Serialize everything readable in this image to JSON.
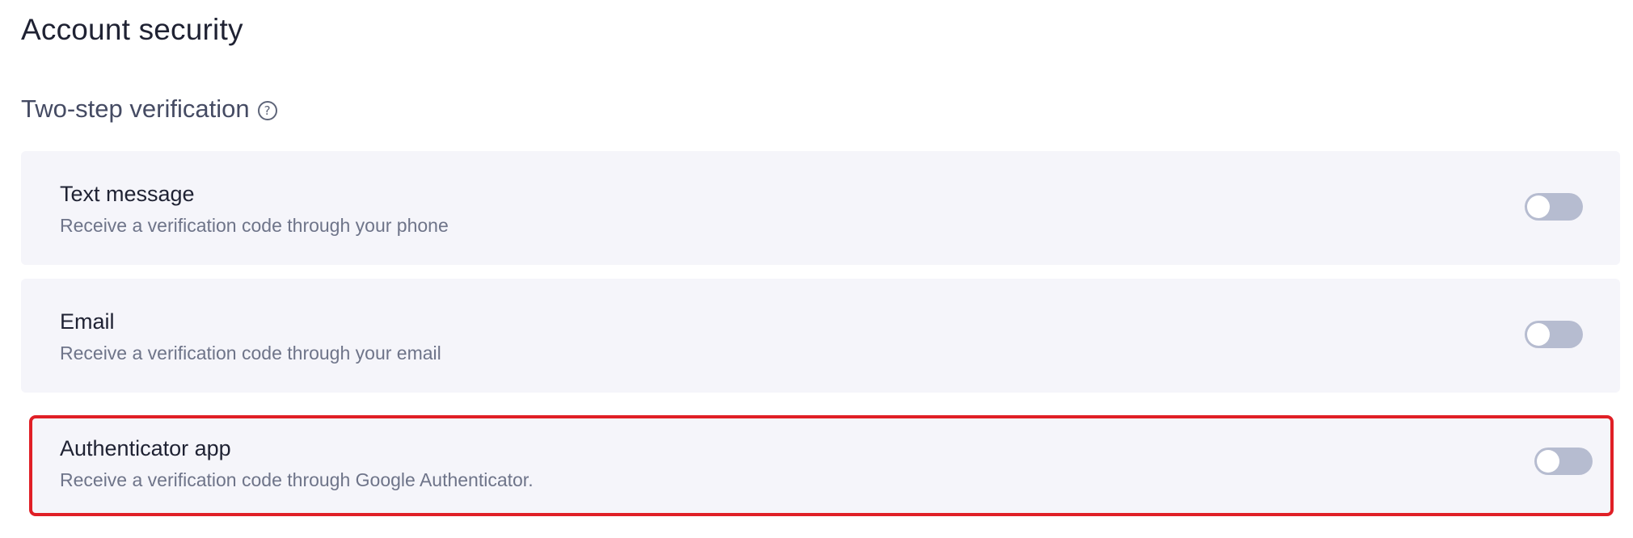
{
  "page": {
    "title": "Account security"
  },
  "two_step": {
    "title": "Two-step verification",
    "help_icon": "question-circle-icon",
    "options": [
      {
        "title": "Text message",
        "description": "Receive a verification code through your phone",
        "enabled": false
      },
      {
        "title": "Email",
        "description": "Receive a verification code through your email",
        "enabled": false
      },
      {
        "title": "Authenticator app",
        "description": "Receive a verification code through Google Authenticator.",
        "enabled": false
      }
    ]
  },
  "colors": {
    "card_background": "#f5f5fa",
    "toggle_off": "#b6bcd0",
    "highlight_border": "#e01f26"
  }
}
